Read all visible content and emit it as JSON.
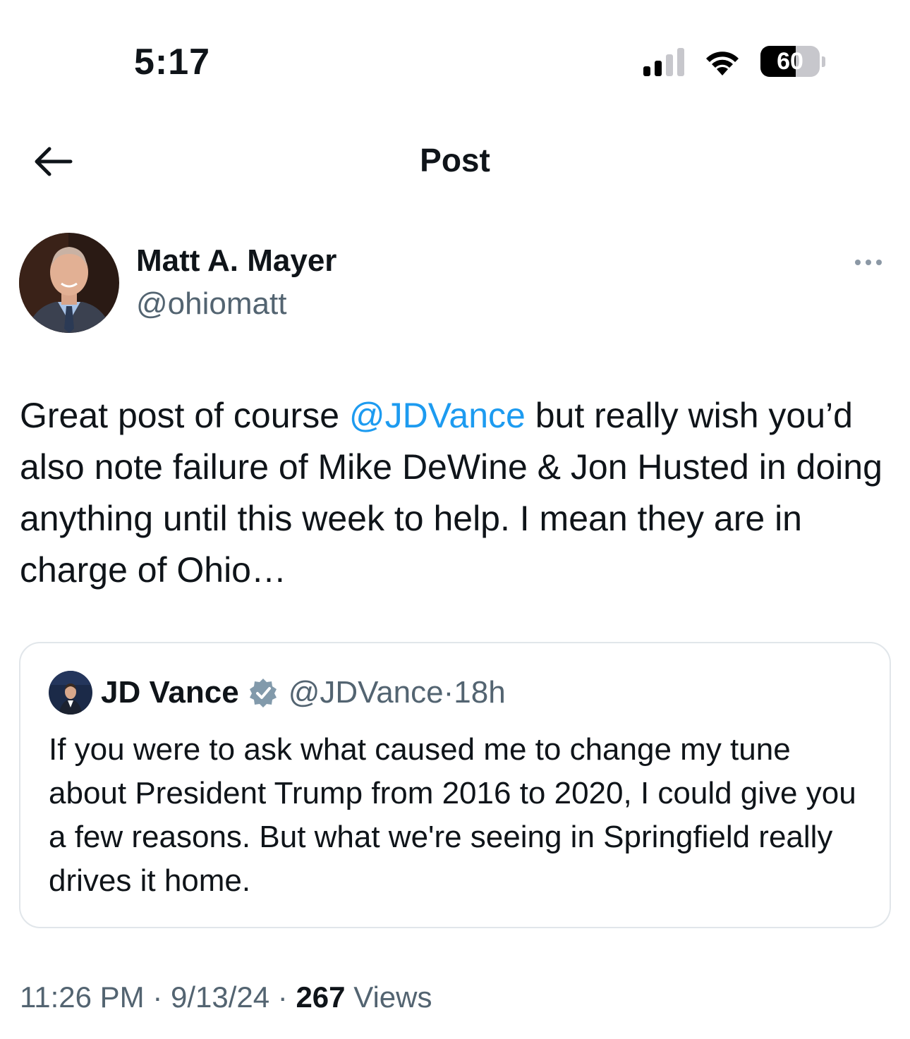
{
  "status_bar": {
    "time": "5:17",
    "battery_level": "60",
    "battery_fraction": 0.6,
    "signal_bars_active": 2,
    "signal_bars_total": 4
  },
  "header": {
    "title": "Post",
    "back_icon": "arrow-left-icon"
  },
  "post": {
    "author_name": "Matt A. Mayer",
    "author_handle": "@ohiomatt",
    "text_before_mention": "Great post of course ",
    "mention": "@JDVance",
    "text_after_mention": " but really wish you’d also note failure of Mike DeWine & Jon Husted in doing anything until this week to help. I mean they are in charge of Ohio…",
    "time": "11:26 PM",
    "date": "9/13/24",
    "views_count": "267",
    "views_label": "Views",
    "separator": " · "
  },
  "quote": {
    "author_name": "JD Vance",
    "author_handle": "@JDVance",
    "age": "18h",
    "verified_icon": "verified-badge-icon",
    "text": "If you were to ask what caused me to change my tune about President Trump from 2016 to 2020, I could give you a few reasons. But what we're seeing in Springfield really drives it home."
  },
  "colors": {
    "accent": "#1d9bf0",
    "secondary_text": "#536471",
    "primary_text": "#0f1419",
    "border": "#e1e6ea",
    "verified": "#829aab"
  }
}
